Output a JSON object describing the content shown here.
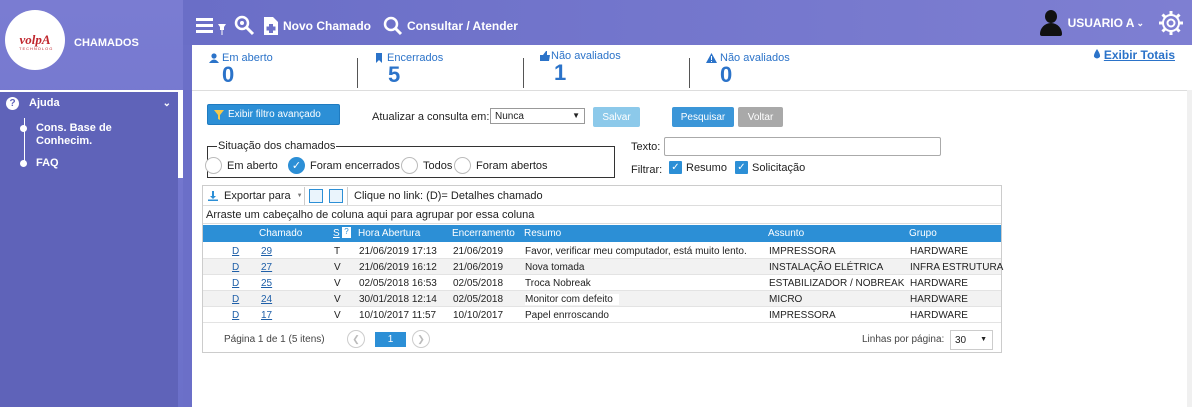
{
  "sidebar": {
    "logo_text": "volpA",
    "logo_sub": "TECHNOLOG",
    "title": "CHAMADOS",
    "help_label": "Ajuda",
    "items": [
      {
        "label_line1": "Cons. Base de",
        "label_line2": "Conhecim."
      },
      {
        "label_line1": "FAQ",
        "label_line2": ""
      }
    ]
  },
  "topbar": {
    "new_ticket_label": "Novo Chamado",
    "consult_label": "Consultar / Atender",
    "user_label": "USUARIO A"
  },
  "stats": [
    {
      "label": "Em aberto",
      "value": "0",
      "icon": "user-icon"
    },
    {
      "label": "Encerrados",
      "value": "5",
      "icon": "bookmark-icon"
    },
    {
      "label": "Não avaliados",
      "value": "1",
      "icon": "thumbs-up-icon"
    },
    {
      "label": "Não avaliados",
      "value": "0",
      "icon": "warning-icon"
    }
  ],
  "stats_totals_link": "Exibir Totais",
  "filters": {
    "advanced_button": "Exibir filtro avançado",
    "refresh_label": "Atualizar a consulta em:",
    "refresh_value": "Nunca",
    "save_button": "Salvar",
    "search_button": "Pesquisar",
    "back_button": "Voltar",
    "status_legend": "Situação dos chamados",
    "status_options": [
      "Em aberto",
      "Foram encerrados",
      "Todos",
      "Foram abertos"
    ],
    "status_selected": "Foram encerrados",
    "text_label": "Texto:",
    "text_value": "",
    "filter_label": "Filtrar:",
    "checkboxes": [
      {
        "label": "Resumo",
        "checked": true
      },
      {
        "label": "Solicitação",
        "checked": true
      }
    ]
  },
  "grid": {
    "export_label": "Exportar para",
    "link_hint": "Clique no link: (D)= Detalhes chamado",
    "group_hint": "Arraste um cabeçalho de coluna aqui para agrupar por essa coluna",
    "columns": [
      "Chamado",
      "S",
      "Hora Abertura",
      "Encerramento",
      "Resumo",
      "Assunto",
      "Grupo"
    ],
    "rows": [
      {
        "d": "D",
        "chamado": "29",
        "s": "T",
        "abertura": "21/06/2019 17:13",
        "encerramento": "21/06/2019",
        "resumo": "Favor, verificar meu computador, está muito lento.",
        "assunto": "IMPRESSORA",
        "grupo": "HARDWARE"
      },
      {
        "d": "D",
        "chamado": "27",
        "s": "V",
        "abertura": "21/06/2019 16:12",
        "encerramento": "21/06/2019",
        "resumo": "Nova tomada",
        "assunto": "INSTALAÇÃO ELÉTRICA",
        "grupo": "INFRA ESTRUTURA"
      },
      {
        "d": "D",
        "chamado": "25",
        "s": "V",
        "abertura": "02/05/2018 16:53",
        "encerramento": "02/05/2018",
        "resumo": "Troca Nobreak",
        "assunto": "ESTABILIZADOR / NOBREAK",
        "grupo": "HARDWARE"
      },
      {
        "d": "D",
        "chamado": "24",
        "s": "V",
        "abertura": "30/01/2018 12:14",
        "encerramento": "02/05/2018",
        "resumo": "Monitor com defeito",
        "assunto": "MICRO",
        "grupo": "HARDWARE"
      },
      {
        "d": "D",
        "chamado": "17",
        "s": "V",
        "abertura": "10/10/2017 11:57",
        "encerramento": "10/10/2017",
        "resumo": "Papel enrroscando",
        "assunto": "IMPRESSORA",
        "grupo": "HARDWARE"
      }
    ],
    "page_info": "Página 1 de 1 (5 itens)",
    "current_page": "1",
    "per_page_label": "Linhas por página:",
    "per_page_value": "30"
  },
  "colors": {
    "accent": "#2c8fd6",
    "sidebar": "#6b70c9",
    "stat_text": "#2b73c9"
  }
}
